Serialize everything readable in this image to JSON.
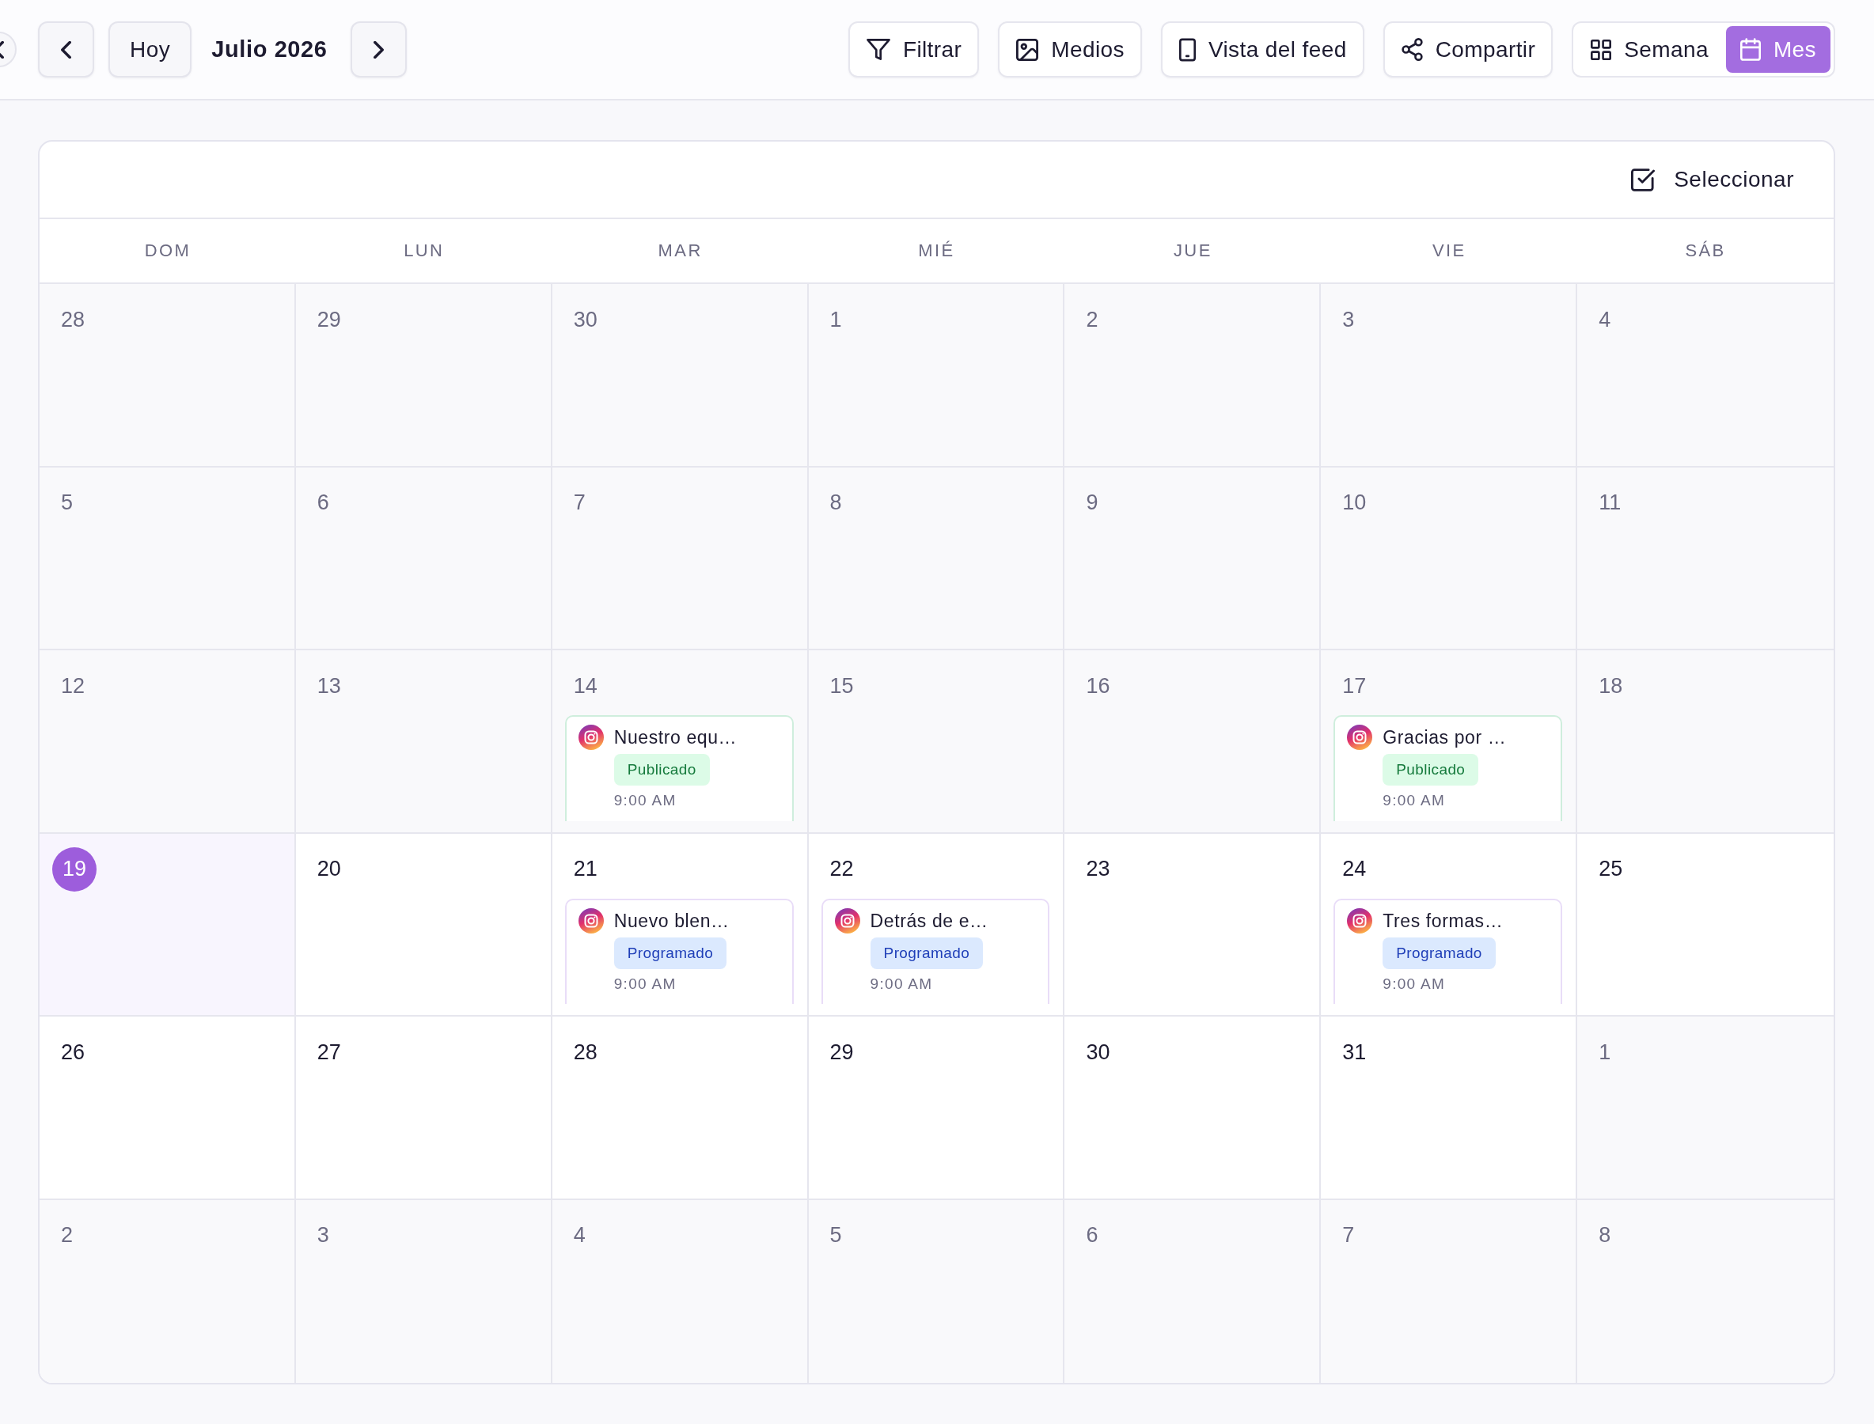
{
  "toolbar": {
    "today_button": "Hoy",
    "title": "Julio 2026",
    "actions": [
      {
        "label": "Filtrar"
      },
      {
        "label": "Medios"
      },
      {
        "label": "Vista del feed"
      },
      {
        "label": "Compartir"
      }
    ],
    "views": [
      {
        "label": "Semana",
        "selected": false
      },
      {
        "label": "Mes",
        "selected": true
      }
    ]
  },
  "calendar": {
    "select_button": "Seleccionar",
    "weekdays": [
      "DOM",
      "LUN",
      "MAR",
      "MIÉ",
      "JUE",
      "VIE",
      "SÁB"
    ],
    "weeks": [
      {
        "days": [
          {
            "day": "28",
            "dimmed": true,
            "today": false
          },
          {
            "day": "29",
            "dimmed": true,
            "today": false
          },
          {
            "day": "30",
            "dimmed": true,
            "today": false
          },
          {
            "day": "1",
            "dimmed": true,
            "today": false
          },
          {
            "day": "2",
            "dimmed": true,
            "today": false
          },
          {
            "day": "3",
            "dimmed": true,
            "today": false
          },
          {
            "day": "4",
            "dimmed": true,
            "today": false
          }
        ]
      },
      {
        "days": [
          {
            "day": "5",
            "dimmed": true,
            "today": false
          },
          {
            "day": "6",
            "dimmed": true,
            "today": false
          },
          {
            "day": "7",
            "dimmed": true,
            "today": false
          },
          {
            "day": "8",
            "dimmed": true,
            "today": false
          },
          {
            "day": "9",
            "dimmed": true,
            "today": false
          },
          {
            "day": "10",
            "dimmed": true,
            "today": false
          },
          {
            "day": "11",
            "dimmed": true,
            "today": false
          }
        ]
      },
      {
        "days": [
          {
            "day": "12",
            "dimmed": true,
            "today": false
          },
          {
            "day": "13",
            "dimmed": true,
            "today": false
          },
          {
            "day": "14",
            "dimmed": true,
            "today": false,
            "events": [
              {
                "kind": "published",
                "title": "Nuestro equ…",
                "status": "Publicado",
                "time": "9:00 AM"
              }
            ]
          },
          {
            "day": "15",
            "dimmed": true,
            "today": false
          },
          {
            "day": "16",
            "dimmed": true,
            "today": false
          },
          {
            "day": "17",
            "dimmed": true,
            "today": false,
            "events": [
              {
                "kind": "published",
                "title": "Gracias por …",
                "status": "Publicado",
                "time": "9:00 AM"
              }
            ]
          },
          {
            "day": "18",
            "dimmed": true,
            "today": false
          }
        ]
      },
      {
        "days": [
          {
            "day": "19",
            "dimmed": false,
            "today": true
          },
          {
            "day": "20",
            "dimmed": false,
            "today": false
          },
          {
            "day": "21",
            "dimmed": false,
            "today": false,
            "events": [
              {
                "kind": "scheduled",
                "title": "Nuevo blen…",
                "status": "Programado",
                "time": "9:00 AM"
              }
            ]
          },
          {
            "day": "22",
            "dimmed": false,
            "today": false,
            "events": [
              {
                "kind": "scheduled",
                "title": "Detrás de e…",
                "status": "Programado",
                "time": "9:00 AM"
              }
            ]
          },
          {
            "day": "23",
            "dimmed": false,
            "today": false
          },
          {
            "day": "24",
            "dimmed": false,
            "today": false,
            "events": [
              {
                "kind": "scheduled",
                "title": "Tres formas…",
                "status": "Programado",
                "time": "9:00 AM"
              }
            ]
          },
          {
            "day": "25",
            "dimmed": false,
            "today": false
          }
        ]
      },
      {
        "days": [
          {
            "day": "26",
            "dimmed": false,
            "today": false
          },
          {
            "day": "27",
            "dimmed": false,
            "today": false
          },
          {
            "day": "28",
            "dimmed": false,
            "today": false
          },
          {
            "day": "29",
            "dimmed": false,
            "today": false
          },
          {
            "day": "30",
            "dimmed": false,
            "today": false
          },
          {
            "day": "31",
            "dimmed": false,
            "today": false
          },
          {
            "day": "1",
            "dimmed": true,
            "today": false
          }
        ]
      },
      {
        "days": [
          {
            "day": "2",
            "dimmed": true,
            "today": false
          },
          {
            "day": "3",
            "dimmed": true,
            "today": false
          },
          {
            "day": "4",
            "dimmed": true,
            "today": false
          },
          {
            "day": "5",
            "dimmed": true,
            "today": false
          },
          {
            "day": "6",
            "dimmed": true,
            "today": false
          },
          {
            "day": "7",
            "dimmed": true,
            "today": false
          },
          {
            "day": "8",
            "dimmed": true,
            "today": false
          }
        ]
      }
    ]
  }
}
